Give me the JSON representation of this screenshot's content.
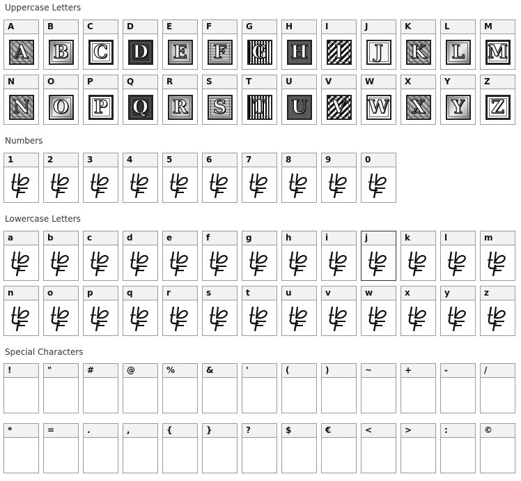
{
  "sections": {
    "uppercase": "Uppercase Letters",
    "numbers": "Numbers",
    "lowercase": "Lowercase Letters",
    "special": "Special Characters"
  },
  "uppercase_row1": [
    "A",
    "B",
    "C",
    "D",
    "E",
    "F",
    "G",
    "H",
    "I",
    "J",
    "K",
    "L",
    "M"
  ],
  "uppercase_row2": [
    "N",
    "O",
    "P",
    "Q",
    "R",
    "S",
    "T",
    "U",
    "V",
    "W",
    "X",
    "Y",
    "Z"
  ],
  "numbers_row": [
    "1",
    "2",
    "3",
    "4",
    "5",
    "6",
    "7",
    "8",
    "9",
    "0"
  ],
  "lowercase_row1": [
    "a",
    "b",
    "c",
    "d",
    "e",
    "f",
    "g",
    "h",
    "i",
    "j",
    "k",
    "l",
    "m"
  ],
  "lowercase_row2": [
    "n",
    "o",
    "p",
    "q",
    "r",
    "s",
    "t",
    "u",
    "v",
    "w",
    "x",
    "y",
    "z"
  ],
  "special_row1": [
    "!",
    "\"",
    "#",
    "@",
    "%",
    "&",
    "'",
    "(",
    ")",
    "~",
    "+",
    "-",
    "/"
  ],
  "special_row2": [
    "*",
    "=",
    ".",
    ",",
    "{",
    "}",
    "?",
    "$",
    "€",
    "<",
    ">",
    ":",
    "©"
  ],
  "placeholder_glyph_icon": "missing-glyph-icon",
  "highlighted_cell": "j"
}
